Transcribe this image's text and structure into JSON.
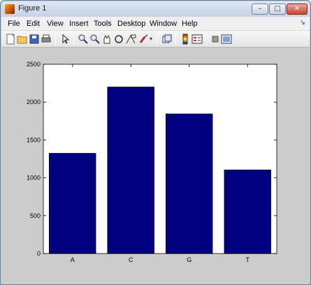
{
  "window": {
    "title": "Figure 1",
    "controls": {
      "minimize": "–",
      "maximize": "□",
      "close": "✕"
    }
  },
  "menubar": {
    "items": [
      "File",
      "Edit",
      "View",
      "Insert",
      "Tools",
      "Desktop",
      "Window",
      "Help"
    ],
    "overflow_icon": "arrow-icon"
  },
  "toolbar": {
    "icons": [
      "new-figure-icon",
      "open-file-icon",
      "save-icon",
      "print-icon",
      "edit-plot-icon",
      "zoom-in-icon",
      "zoom-out-icon",
      "pan-icon",
      "rotate-3d-icon",
      "data-cursor-icon",
      "brush-icon",
      "link-plot-icon",
      "colorbar-icon",
      "legend-icon",
      "hide-plot-tools-icon",
      "show-plot-tools-icon"
    ]
  },
  "chart_data": {
    "type": "bar",
    "categories": [
      "A",
      "C",
      "G",
      "T"
    ],
    "values": [
      1325,
      2200,
      1845,
      1105
    ],
    "ylim": [
      0,
      2500
    ],
    "yticks": [
      0,
      500,
      1000,
      1500,
      2000,
      2500
    ],
    "bar_color": "#000080",
    "grid": false,
    "title": "",
    "xlabel": "",
    "ylabel": ""
  }
}
